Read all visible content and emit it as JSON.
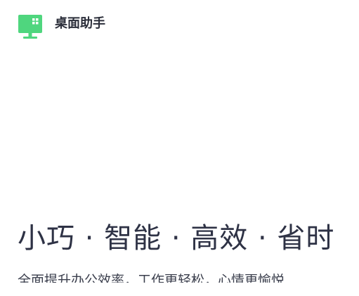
{
  "app": {
    "name": "桌面助手",
    "accent_color": "#4fd67e"
  },
  "hero": {
    "tagline": "小巧 · 智能 · 高效 · 省时",
    "subtitle": "全面提升办公效率，工作更轻松，心情更愉悦"
  }
}
